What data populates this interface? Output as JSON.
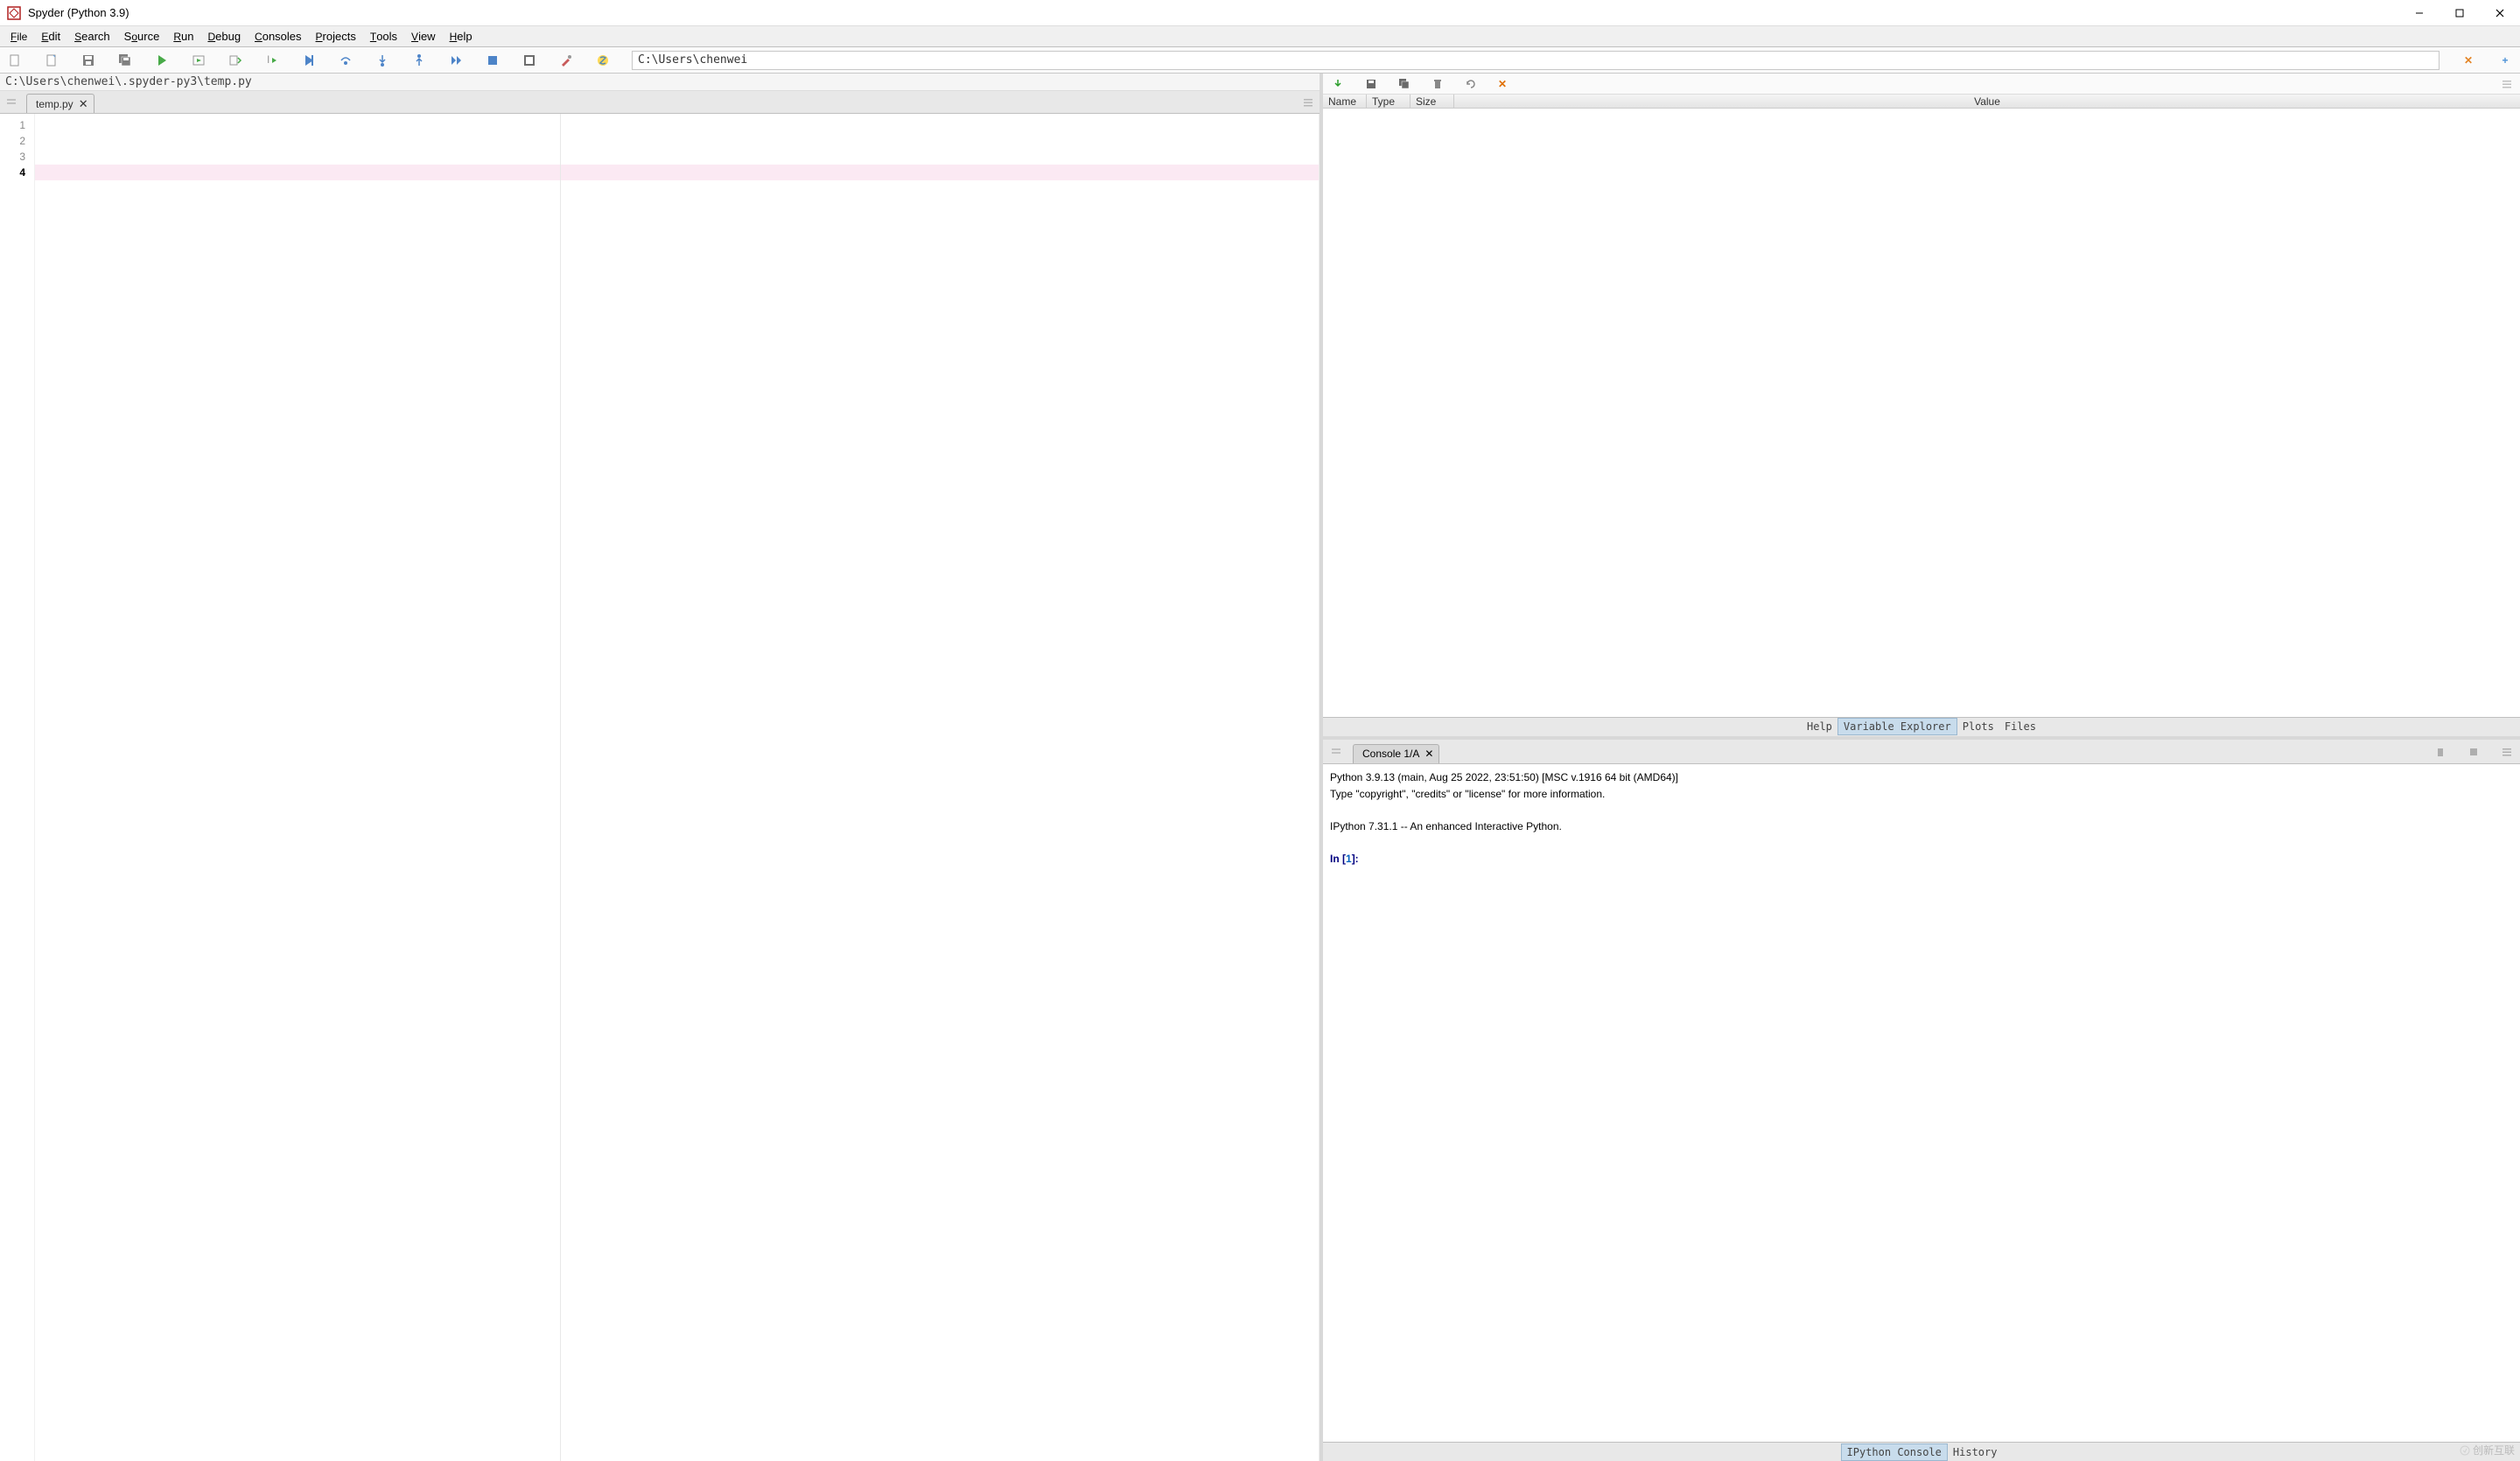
{
  "titlebar": {
    "title": "Spyder (Python 3.9)"
  },
  "menubar": {
    "file": "File",
    "edit": "Edit",
    "search": "Search",
    "source": "Source",
    "run": "Run",
    "debug": "Debug",
    "consoles": "Consoles",
    "projects": "Projects",
    "tools": "Tools",
    "view": "View",
    "help": "Help"
  },
  "toolbar": {
    "path": "C:\\Users\\chenwei"
  },
  "editor": {
    "file_path": "C:\\Users\\chenwei\\.spyder-py3\\temp.py",
    "tab_label": "temp.py",
    "line_numbers": [
      "1",
      "2",
      "3",
      "4"
    ],
    "current_line": 4
  },
  "varexp": {
    "headers": {
      "name": "Name",
      "type": "Type",
      "size": "Size",
      "value": "Value"
    },
    "tabs": {
      "help": "Help",
      "variable_explorer": "Variable Explorer",
      "plots": "Plots",
      "files": "Files"
    }
  },
  "console": {
    "tab_label": "Console 1/A",
    "banner_line1": "Python 3.9.13 (main, Aug 25 2022, 23:51:50) [MSC v.1916 64 bit (AMD64)]",
    "banner_line2": "Type \"copyright\", \"credits\" or \"license\" for more information.",
    "banner_line3": "IPython 7.31.1 -- An enhanced Interactive Python.",
    "prompt_in": "In [",
    "prompt_num": "1",
    "prompt_close": "]:",
    "bottom_tabs": {
      "ipython": "IPython Console",
      "history": "History"
    }
  },
  "watermark": "创新互联"
}
